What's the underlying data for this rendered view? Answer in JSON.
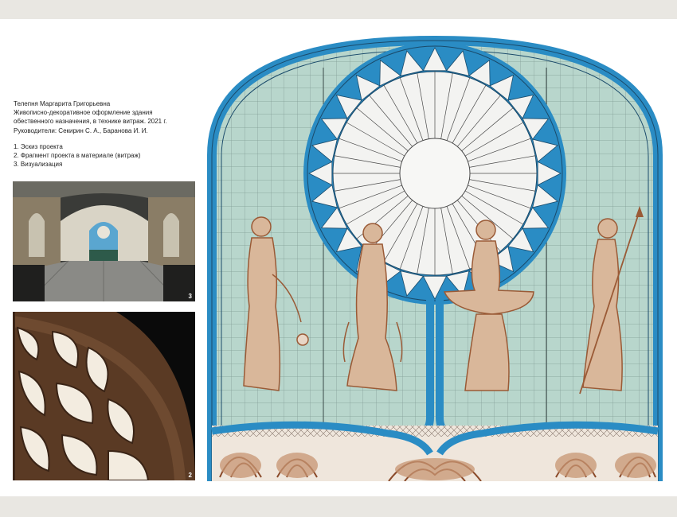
{
  "caption": {
    "author": "Телепня Маргарита Григорьевна",
    "title_line1": "Живописно-декоративное оформление здания",
    "title_line2": "обественного назначения, в технике витраж. 2021 г.",
    "supervisors": "Руководители: Секирин С. А., Баранова И. И.",
    "items": [
      "1. Эскиз проекта",
      "2. Фрагмент проекта в материале (витраж)",
      "3. Визуализация"
    ]
  },
  "photos": {
    "hall_number": "3",
    "fragment_number": "2"
  },
  "colors": {
    "frame_blue": "#2a8cc4",
    "glass_mint": "#b8d6cc",
    "sepia": "#b77a56",
    "sheet_bg": "#ffffff",
    "page_bg": "#e9e7e2"
  }
}
